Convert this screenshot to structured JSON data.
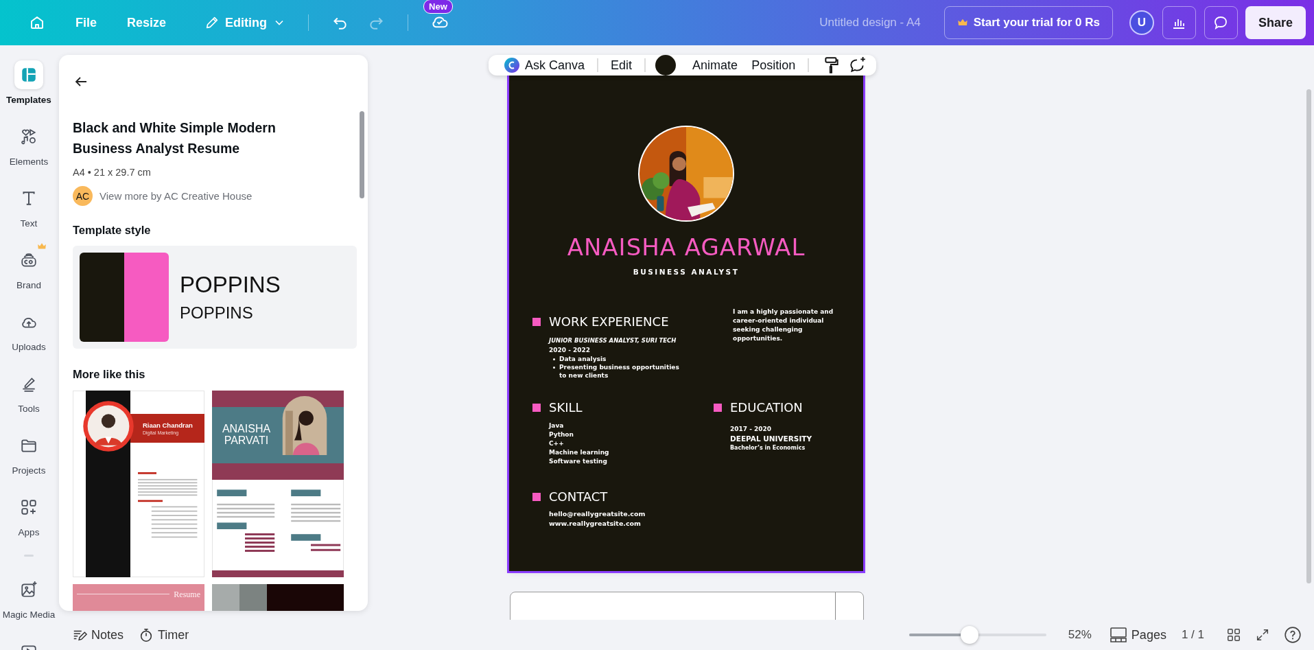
{
  "top_bar": {
    "menu": [
      {
        "label": "File"
      },
      {
        "label": "Resize"
      }
    ],
    "mode": "Editing",
    "new_badge": "New",
    "doc_title": "Untitled design - A4",
    "trial_button": "Start your trial for 0 Rs",
    "avatar": "U",
    "share": "Share"
  },
  "rail": [
    {
      "kind": "templates",
      "label": "Templates",
      "selected": true,
      "premium": false
    },
    {
      "kind": "elements",
      "label": "Elements",
      "selected": false,
      "premium": false
    },
    {
      "kind": "text",
      "label": "Text",
      "selected": false,
      "premium": false
    },
    {
      "kind": "brand",
      "label": "Brand",
      "selected": false,
      "premium": true
    },
    {
      "kind": "uploads",
      "label": "Uploads",
      "selected": false,
      "premium": false
    },
    {
      "kind": "tools",
      "label": "Tools",
      "selected": false,
      "premium": false
    },
    {
      "kind": "projects",
      "label": "Projects",
      "selected": false,
      "premium": false
    },
    {
      "kind": "apps",
      "label": "Apps",
      "selected": false,
      "premium": false
    },
    {
      "kind": "divider"
    },
    {
      "kind": "magic",
      "label": "Magic Media",
      "selected": false,
      "premium": false
    },
    {
      "kind": "video",
      "selected": false,
      "premium": false
    }
  ],
  "panel": {
    "title": "Black and White Simple Modern Business Analyst Resume",
    "size": "A4 • 21 x 29.7 cm",
    "author_initials": "AC",
    "author_link": "View more by AC Creative House",
    "style_heading": "Template style",
    "swatches": [
      {
        "color": "#19170d"
      },
      {
        "color": "#f65bc1"
      }
    ],
    "fonts": [
      "POPPINS",
      "POPPINS"
    ],
    "more_heading": "More like this",
    "templates": [
      {
        "kind": "red-sidebar",
        "title": "Riaan Chandran",
        "subtitle": "Digital Marketing"
      },
      {
        "kind": "teal-banner",
        "title": "ANAISHA PARVATI"
      },
      {
        "kind": "pink-band",
        "title": "Resume"
      },
      {
        "kind": "dark-split"
      }
    ]
  },
  "toolbar": {
    "ask": "Ask Canva",
    "edit": "Edit",
    "color": "#19170d",
    "animate": "Animate",
    "position": "Position"
  },
  "resume": {
    "name": "ANAISHA AGARWAL",
    "role": "BUSINESS ANALYST",
    "work": {
      "heading": "WORK EXPERIENCE",
      "job": "JUNIOR BUSINESS ANALYST, SURI TECH",
      "dates": "2020 - 2022",
      "bullets": [
        "Data analysis",
        "Presenting business opportunities to new clients"
      ]
    },
    "about": "I am a highly passionate and career-oriented individual seeking challenging opportunities.",
    "skill": {
      "heading": "SKILL",
      "items": [
        "Java",
        "Python",
        "C++",
        "Machine learning",
        "Software testing"
      ]
    },
    "education": {
      "heading": "EDUCATION",
      "dates": "2017 - 2020",
      "school": "DEEPAL UNIVERSITY",
      "degree": "Bachelor’s in Economics"
    },
    "contact": {
      "heading": "CONTACT",
      "lines": [
        "hello@reallygreatsite.com",
        "www.reallygreatsite.com"
      ]
    }
  },
  "status_bar": {
    "notes": "Notes",
    "timer": "Timer",
    "zoom": {
      "level": 0.44
    },
    "zoom_text": "52%",
    "pages": "Pages",
    "page_count": "1 / 1"
  }
}
